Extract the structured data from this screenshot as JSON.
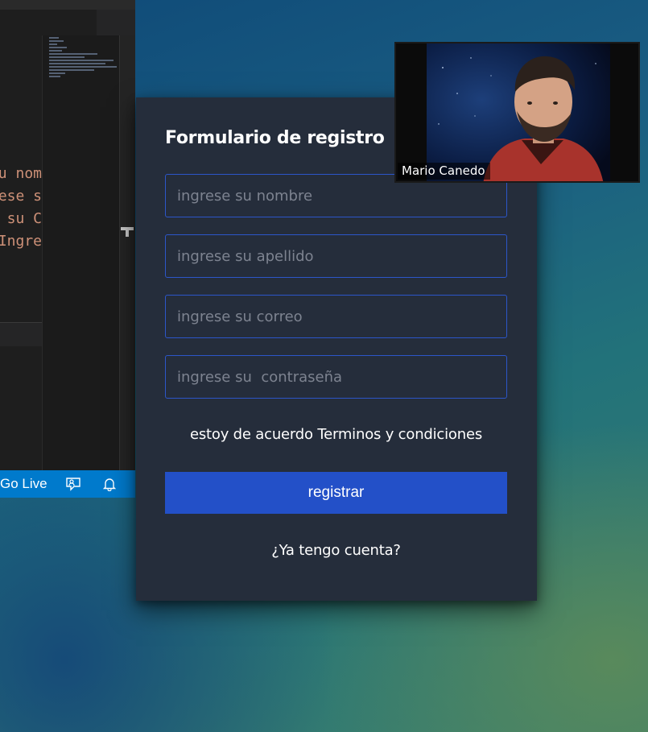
{
  "editor": {
    "code_lines": [
      "su nom",
      "ese s",
      "su C",
      "Ingre"
    ],
    "statusbar": {
      "go_live_label": "Go Live",
      "feedback_icon": "feedback-person-icon",
      "notification_icon": "bell-icon",
      "accent_color": "#007acc"
    }
  },
  "form": {
    "title": "Formulario de registro",
    "fields": {
      "nombre_placeholder": "ingrese su nombre",
      "apellido_placeholder": "ingrese su apellido",
      "correo_placeholder": "ingrese su correo",
      "password_placeholder": "ingrese su  contraseña"
    },
    "terms_text": "estoy de acuerdo Terminos y condiciones",
    "submit_label": "registrar",
    "login_link": "¿Ya tengo cuenta?",
    "accent_color": "#2350c8",
    "card_color": "#252d3b"
  },
  "video_call": {
    "participant_name": "Mario Canedo"
  }
}
